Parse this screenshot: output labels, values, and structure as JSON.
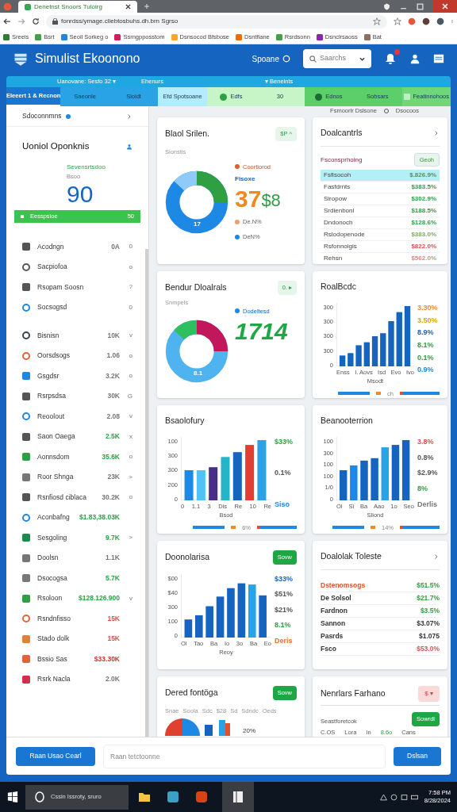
{
  "browser": {
    "tab_title": "Denetnst Snoors Tuloirg",
    "url": "fonrdss/ymage.cliebtosbuhs.dh.brn Sgrso",
    "bookmarks": [
      {
        "label": "Sreeis",
        "color": "#2e7d32"
      },
      {
        "label": "Bsrt",
        "color": "#43a047"
      },
      {
        "label": "Seoil Sorkeg o",
        "color": "#1e88e5"
      },
      {
        "label": "Ssrngpposstom",
        "color": "#d81b60"
      },
      {
        "label": "Dsnsocod Bfsbose",
        "color": "#f9a825"
      },
      {
        "label": "Dsntfiane",
        "color": "#ef6c00"
      },
      {
        "label": "Rsrdsonn",
        "color": "#43a047"
      },
      {
        "label": "Dsnclrsaoss",
        "color": "#8e24aa"
      },
      {
        "label": "Bat",
        "color": "#8d6e63"
      }
    ]
  },
  "header": {
    "title": "Simulist Ekoonono",
    "user_label": "Spoane",
    "search": {
      "placeholder": "Saarchs"
    },
    "notification_badge": true
  },
  "nav": {
    "info": [
      "Uanovane: Sesfo 32 ▾",
      "Ehenurs",
      "▾ Benelnts"
    ],
    "tabs": [
      {
        "label": "Eleeert 1 & Recnon",
        "color": "#1976d2",
        "selected": true
      },
      {
        "label": "Saeonle",
        "color": "#29a3e6",
        "selected": false
      },
      {
        "label": "Sloidt",
        "color": "#29a3e6",
        "selected": false
      },
      {
        "label": "Efd Spotsoane",
        "color": "#b3ecfc",
        "selected": false
      },
      {
        "label": "Edfs",
        "color": "#c8f5c8",
        "selected": false
      },
      {
        "label": "30",
        "color": "#c8f5c8",
        "selected": false
      },
      {
        "label": "Ednos",
        "color": "#5ccf6a",
        "selected": false
      },
      {
        "label": "Sobsars",
        "color": "#5ccf6a",
        "selected": false
      },
      {
        "label": "Featinnohoos",
        "color": "#6fd67a",
        "selected": false
      }
    ]
  },
  "sidebar": {
    "title": "Sdoconnmns",
    "card": {
      "title": "Uoniol Oponknis",
      "label": "Sevensrtsdoo",
      "sublabel": "Bsoo",
      "value": "90",
      "bar_label": "Eesspsioe",
      "bar_value": "50"
    },
    "groups": [
      [
        {
          "label": "Acodngn",
          "value": {
            "text": "0A",
            "color": "#777777"
          },
          "color": "#555555",
          "trail": "0"
        },
        {
          "label": "Sacpiofoa",
          "color": "#555555",
          "trail": "o"
        },
        {
          "label": "Rsopam Soosn",
          "color": "#555555",
          "trail": "?"
        },
        {
          "label": "Socsogsd",
          "color": "#1e88e5",
          "trail": "0"
        }
      ],
      [
        {
          "label": "Bisnisn",
          "value": {
            "text": "10K",
            "color": "#777777"
          },
          "color": "#37474f",
          "trail": "v"
        },
        {
          "label": "Oorsdsogs",
          "value": {
            "text": "1.06",
            "color": "#777777"
          },
          "color": "#e0643a",
          "trail": "o"
        },
        {
          "label": "Gsgdsr",
          "value": {
            "text": "3.2K",
            "color": "#777777"
          },
          "color": "#1e88e5",
          "trail": "o"
        },
        {
          "label": "Rsrpsdsa",
          "value": {
            "text": "30K",
            "color": "#777777"
          },
          "color": "#555555",
          "trail": "G"
        },
        {
          "label": "Reoolout",
          "value": {
            "text": "2.08",
            "color": "#777777"
          },
          "color": "#1e88e5",
          "trail": "v"
        },
        {
          "label": "Saon Oaega",
          "value": {
            "text": "2.5K",
            "color": "#2ea043"
          },
          "color": "#555555",
          "trail": "x"
        },
        {
          "label": "Aonnsdom",
          "value": {
            "text": "35.6K",
            "color": "#2ea043"
          },
          "color": "#2ea043",
          "trail": "o"
        },
        {
          "label": "Roor Shnga",
          "value": {
            "text": "23K",
            "color": "#777777"
          },
          "color": "#777777",
          "trail": ">"
        },
        {
          "label": "Rsnfiosd ciblaca",
          "value": {
            "text": "30.2K",
            "color": "#777777"
          },
          "color": "#555555",
          "trail": "o"
        },
        {
          "label": "Aconbafng",
          "value": {
            "text": "$1.83,38.03K",
            "color": "#2ea043"
          },
          "color": "#1e88e5"
        },
        {
          "label": "Sesgoling",
          "value": {
            "text": "9.7K",
            "color": "#2ea043"
          },
          "color": "#1b8a4a",
          "trail": ">"
        },
        {
          "label": "Doolsn",
          "value": {
            "text": "1.1K",
            "color": "#777777"
          },
          "color": "#777777"
        },
        {
          "label": "Dsocogsa",
          "value": {
            "text": "5.7K",
            "color": "#2ea043"
          },
          "color": "#777777"
        },
        {
          "label": "Rsoloon",
          "value": {
            "text": "$128.126.900",
            "color": "#2ea043"
          },
          "color": "#2ea043",
          "trail": "v"
        },
        {
          "label": "Rsndnfisso",
          "value": {
            "text": "15K",
            "color": "#e05050"
          },
          "color": "#e0643a"
        },
        {
          "label": "Stado dolk",
          "value": {
            "text": "15K",
            "color": "#e05050"
          },
          "color": "#e0803a"
        },
        {
          "label": "Bssio Sas",
          "value": {
            "text": "$33.30K",
            "color": "#d03030"
          },
          "color": "#e0643a"
        },
        {
          "label": "Rsrk Nacla",
          "value": {
            "text": "2.0K",
            "color": "#777777"
          },
          "color": "#d0304a"
        }
      ]
    ]
  },
  "content": {
    "toolbar": [
      "Fsmoorlr Dslsone",
      "Dsocoos"
    ],
    "cards": [
      {
        "kind": "donut",
        "title": "Blaol Srilen.",
        "subtitle": "Sionstis",
        "badge": "$P ^",
        "top_legend": "Coortiorod",
        "label": "Fisoxe",
        "big": "37",
        "big_suffix": "$8",
        "center": "17",
        "legend": [
          {
            "label": "De.N%",
            "color": "#f0a070"
          },
          {
            "label": "DeN%",
            "color": "#1e88e5"
          }
        ]
      },
      {
        "kind": "table",
        "title": "Doalcantrls",
        "section": "Fsconsprhoing",
        "button": "Geoh",
        "rows": [
          {
            "name": "Fsfisocoh",
            "value": "$.826.9%",
            "color": "#5a8a60",
            "selected": true
          },
          {
            "name": "Fasfdrnts",
            "value": "$383.5%",
            "color": "#2ea043",
            "selected": false
          },
          {
            "name": "Siropow",
            "value": "$302.9%",
            "color": "#2ea043",
            "selected": false
          },
          {
            "name": "Srdienbonl",
            "value": "$188.5%",
            "color": "#2ea043",
            "selected": false
          },
          {
            "name": "Dndonoch",
            "value": "$128.6%",
            "color": "#2ea043",
            "selected": false
          },
          {
            "name": "Rslodopenode",
            "value": "$383.0%",
            "color": "#7cb342",
            "selected": false
          },
          {
            "name": "Rsfonnoigis",
            "value": "$822.0%",
            "color": "#e05050",
            "selected": false
          },
          {
            "name": "Rehsn",
            "value": "$562.0%",
            "color": "#e88080",
            "selected": false
          }
        ]
      },
      {
        "kind": "donut2",
        "title": "Bendur Dloalrals",
        "subtitle": "Snmpels",
        "badge": "0. ▸",
        "top_legend": "Dodeltesd",
        "big": "1714",
        "center": "8.1"
      },
      {
        "kind": "bars",
        "title": "RoalBcdc",
        "yticks": [
          "300",
          "300",
          "300",
          "300",
          "0"
        ],
        "xlabels": [
          "Enss",
          "I. Aovs",
          "Isd",
          "Evo",
          "Ivo"
        ],
        "xlabel": "Msodt",
        "right": [
          {
            "text": "3.30%",
            "color": "#f08a30"
          },
          {
            "text": "3.50%",
            "color": "#d4a800"
          },
          {
            "text": "8.9%",
            "color": "#1565c0"
          },
          {
            "text": "8.1%",
            "color": "#2ea043"
          },
          {
            "text": "0.1%",
            "color": "#2ea043"
          },
          {
            "text": "0.9%",
            "color": "#1e88e5"
          }
        ],
        "legend": "ch"
      },
      {
        "kind": "bars",
        "title": "Bsaolofury",
        "yticks": [
          "100",
          "300",
          "300",
          "200",
          "0"
        ],
        "xlabels": [
          "0",
          "1.1",
          "3",
          "Dis",
          "Re",
          "10",
          "Re"
        ],
        "xlabel": "Bsod",
        "right": [
          {
            "text": "$33%",
            "color": "#2ea043"
          },
          {
            "text": "0.1%",
            "color": "#555555"
          },
          {
            "text": "Siso",
            "color": "#1e88e5"
          }
        ],
        "legend": "6%"
      },
      {
        "kind": "bars",
        "title": "Beanooterrion",
        "yticks": [
          "100",
          "300",
          "100",
          "100",
          "1/0",
          "0"
        ],
        "xlabels": [
          "Oi",
          "Si",
          "Ba",
          "Aao",
          "1o",
          "Seo"
        ],
        "xlabel": "Sliond",
        "right": [
          {
            "text": "3.8%",
            "color": "#e05050"
          },
          {
            "text": "0.8%",
            "color": "#555555"
          },
          {
            "text": "$2.9%",
            "color": "#555555"
          },
          {
            "text": "8%",
            "color": "#2ea043"
          },
          {
            "text": "Derlis",
            "color": "#777777"
          }
        ],
        "legend": "14%"
      },
      {
        "kind": "bars",
        "title": "Doonolarisa",
        "button": "Sovw",
        "yticks": [
          "$00",
          "$40",
          "300",
          "100",
          "0"
        ],
        "xlabels": [
          "Oi",
          "Tao",
          "Ba",
          "Io",
          "3o",
          "Ba",
          "Eo"
        ],
        "xlabel": "Reoy",
        "right": [
          {
            "text": "$33%",
            "color": "#1565c0"
          },
          {
            "text": "$51%",
            "color": "#555555"
          },
          {
            "text": "$21%",
            "color": "#555555"
          },
          {
            "text": "8.1%",
            "color": "#2ea043"
          },
          {
            "text": "Deris",
            "color": "#e07840"
          }
        ]
      },
      {
        "kind": "table2",
        "title": "Doalolak Toleste",
        "rows": [
          {
            "name": {
              "text": "Dstenomsogs",
              "color": "#e05030"
            },
            "value": "$51.5%",
            "color": "#2ea043"
          },
          {
            "name": {
              "text": "De Solsol",
              "color": "#333333"
            },
            "value": "$21.7%",
            "color": "#2ea043"
          },
          {
            "name": {
              "text": "Fardnon",
              "color": "#333333"
            },
            "value": "$3.5%",
            "color": "#2ea043"
          },
          {
            "name": {
              "text": "Sannon",
              "color": "#333333"
            },
            "value": "$3.07%",
            "color": "#333333"
          },
          {
            "name": {
              "text": "Pasrds",
              "color": "#333333"
            },
            "value": "$1.075",
            "color": "#333333"
          },
          {
            "name": {
              "text": "Fsco",
              "color": "#333333"
            },
            "value": "$53.0%",
            "color": "#e05050"
          }
        ]
      },
      {
        "kind": "partial",
        "title": "Dered fontöga",
        "button": "Sovw",
        "labels": [
          "Snae",
          "Soola",
          "Sdc",
          "$28",
          "Sd",
          "Sdndc",
          "Oeds"
        ],
        "note": "20%"
      },
      {
        "kind": "notice",
        "title": "Nenrlars Farhano",
        "badge": "$ ▾",
        "button": "Sowrdl",
        "text": "Seastforetcok",
        "labels": [
          "C.OS",
          "Lora",
          "In",
          "8.6o",
          "Cans"
        ]
      }
    ]
  },
  "footer": {
    "primary": "Raan Usao Cearl",
    "field": {
      "placeholder": "Raan tetctoonne"
    },
    "secondary": "Dslsan"
  },
  "taskbar": {
    "search": "Cssin Issroty, sruro",
    "time": "7:58 PM",
    "date": "8/28/2024"
  }
}
